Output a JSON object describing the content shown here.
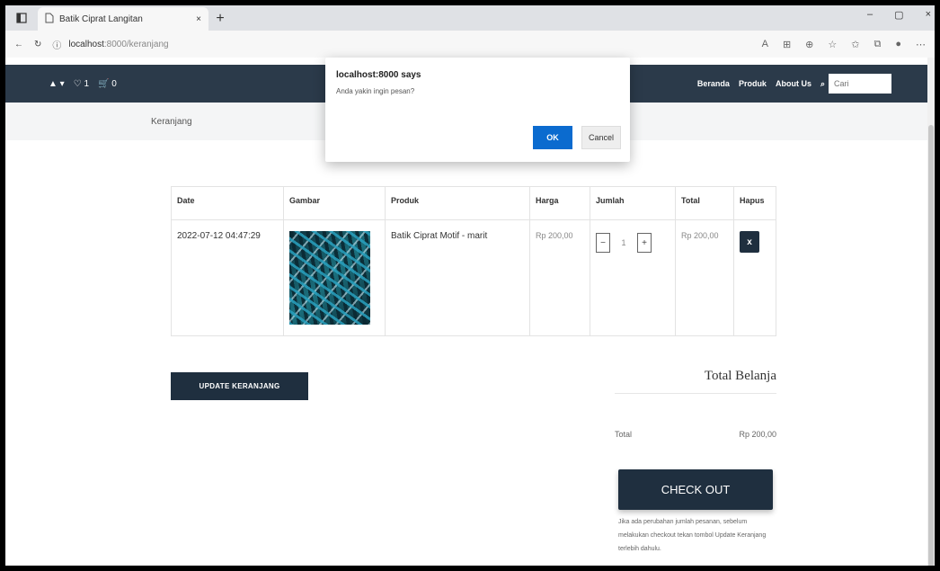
{
  "browser": {
    "tab_title": "Batik Ciprat Langitan",
    "tab_close": "×",
    "new_tab": "+",
    "url_host": "localhost",
    "url_path": ":8000/keranjang",
    "window_controls": [
      "–",
      "▢",
      "×"
    ]
  },
  "navbar": {
    "left_icons": [
      "▲ ▾",
      "♡ 1",
      "🛒 0"
    ],
    "links": [
      "Beranda",
      "Produk",
      "About Us"
    ],
    "search_placeholder": "Cari"
  },
  "breadcrumb": "Keranjang",
  "table": {
    "headers": [
      "Date",
      "Gambar",
      "Produk",
      "Harga",
      "Jumlah",
      "Total",
      "Hapus"
    ],
    "rows": [
      {
        "date": "2022-07-12 04:47:29",
        "product": "Batik Ciprat Motif - marit",
        "price": "Rp 200,00",
        "qty": "1",
        "total": "Rp 200,00",
        "delete": "x"
      }
    ]
  },
  "update_button": "UPDATE KERANJANG",
  "totals": {
    "title": "Total Belanja",
    "label": "Total",
    "value": "Rp 200,00",
    "checkout": "CHECK OUT",
    "note": "Jika ada perubahan jumlah pesanan, sebelum melakukan checkout tekan tombol Update Keranjang terlebih dahulu."
  },
  "dialog": {
    "title": "localhost:8000 says",
    "message": "Anda yakin ingin pesan?",
    "ok": "OK",
    "cancel": "Cancel"
  }
}
